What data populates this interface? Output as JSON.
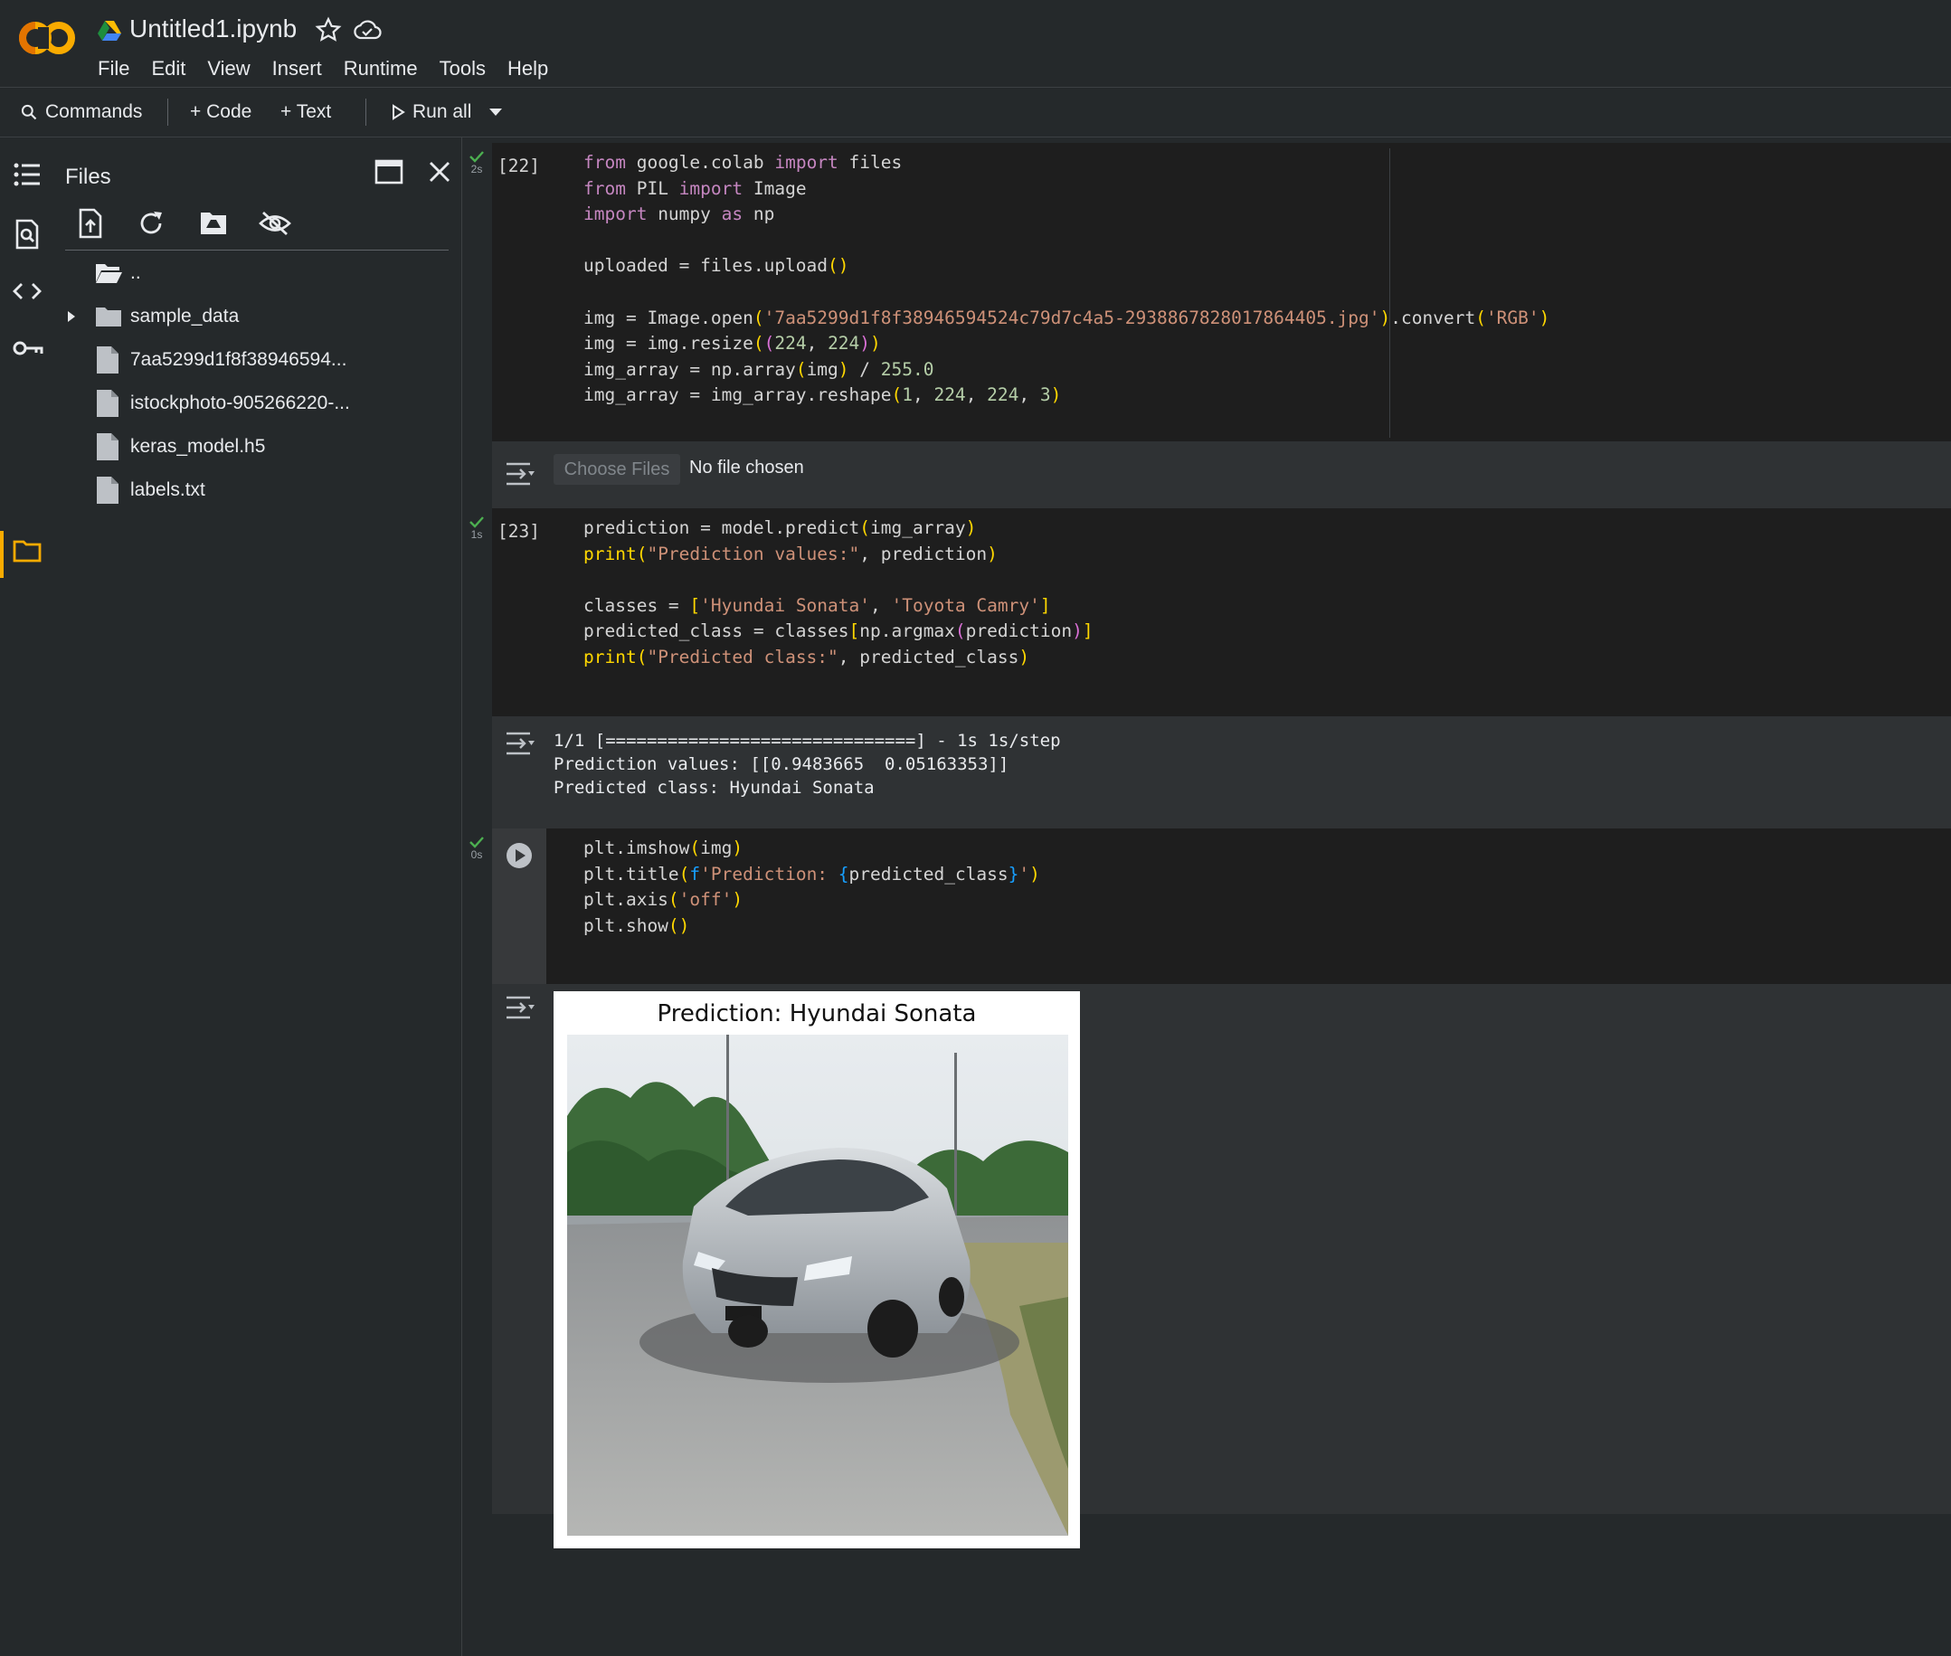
{
  "header": {
    "title": "Untitled1.ipynb",
    "logo_text": "CO",
    "menu": [
      "File",
      "Edit",
      "View",
      "Insert",
      "Runtime",
      "Tools",
      "Help"
    ]
  },
  "toolbar": {
    "commands_label": "Commands",
    "code_label": "+ Code",
    "text_label": "+ Text",
    "run_all_label": "Run all"
  },
  "files_panel": {
    "title": "Files",
    "parent_dir": "..",
    "items": [
      {
        "name": "sample_data",
        "type": "folder"
      },
      {
        "name": "7aa5299d1f8f38946594...",
        "type": "file"
      },
      {
        "name": "istockphoto-905266220-...",
        "type": "file"
      },
      {
        "name": "keras_model.h5",
        "type": "file"
      },
      {
        "name": "labels.txt",
        "type": "file"
      }
    ]
  },
  "cells": [
    {
      "exec_count": "[22]",
      "time": "2s",
      "output_button": "Choose Files",
      "output_status": "No file chosen"
    },
    {
      "exec_count": "[23]",
      "time": "1s",
      "output_lines": [
        "1/1 [==============================] - 1s 1s/step",
        "Prediction values: [[0.9483665  0.05163353]]",
        "Predicted class: Hyundai Sonata"
      ]
    },
    {
      "exec_count": "",
      "time": "0s",
      "plot_title": "Prediction: Hyundai Sonata"
    }
  ],
  "colors": {
    "background": "#25292b",
    "cell_bg": "#1e1e1e",
    "output_bg": "#2f3234",
    "accent": "#f9ab00",
    "success": "#4caf50"
  }
}
